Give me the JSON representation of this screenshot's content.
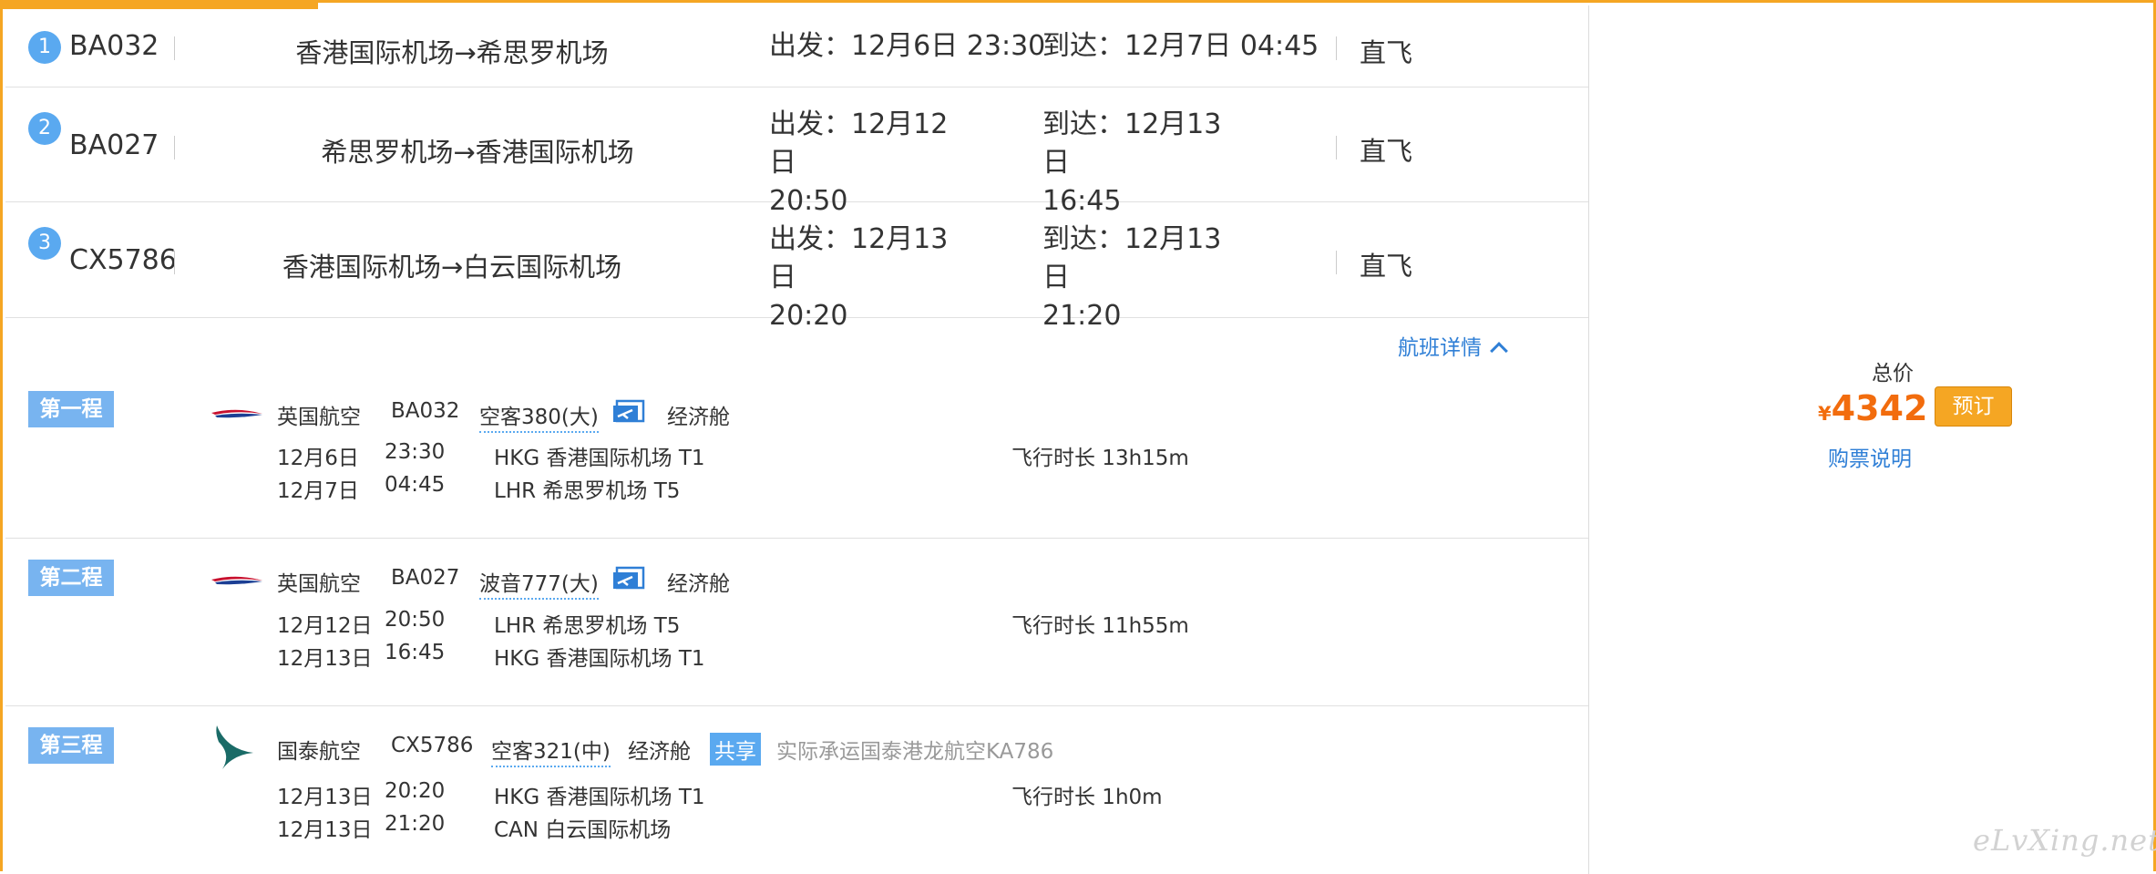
{
  "segments": [
    {
      "num": "1",
      "flight": "BA032",
      "route": "香港国际机场→希思罗机场",
      "dep_label": "出发：",
      "dep_date": "12月6日",
      "dep_time": "23:30",
      "arr_label": "到达：",
      "arr_date": "12月7日",
      "arr_time": "04:45",
      "type": "直飞"
    },
    {
      "num": "2",
      "flight": "BA027",
      "route": "希思罗机场→香港国际机场",
      "dep_label": "出发：",
      "dep_date": "12月12日",
      "dep_time": "20:50",
      "arr_label": "到达：",
      "arr_date": "12月13日",
      "arr_time": "16:45",
      "type": "直飞"
    },
    {
      "num": "3",
      "flight": "CX5786",
      "route": "香港国际机场→白云国际机场",
      "dep_label": "出发：",
      "dep_date": "12月13日",
      "dep_time": "20:20",
      "arr_label": "到达：",
      "arr_date": "12月13日",
      "arr_time": "21:20",
      "type": "直飞"
    }
  ],
  "details_link": "航班详情",
  "legs": [
    {
      "badge": "第一程",
      "airline": "英国航空",
      "flight": "BA032",
      "aircraft": "空客380(大)",
      "cabin": "经济舱",
      "has_meal": true,
      "dep_date": "12月6日",
      "dep_time": "23:30",
      "dep_airport": "HKG 香港国际机场 T1",
      "arr_date": "12月7日",
      "arr_time": "04:45",
      "arr_airport": "LHR 希思罗机场 T5",
      "duration": "飞行时长 13h15m"
    },
    {
      "badge": "第二程",
      "airline": "英国航空",
      "flight": "BA027",
      "aircraft": "波音777(大)",
      "cabin": "经济舱",
      "has_meal": true,
      "dep_date": "12月12日",
      "dep_time": "20:50",
      "dep_airport": "LHR 希思罗机场 T5",
      "arr_date": "12月13日",
      "arr_time": "16:45",
      "arr_airport": "HKG 香港国际机场 T1",
      "duration": "飞行时长 11h55m"
    },
    {
      "badge": "第三程",
      "airline": "国泰航空",
      "flight": "CX5786",
      "aircraft": "空客321(中)",
      "cabin": "经济舱",
      "share": "共享",
      "operated_by": "实际承运国泰港龙航空KA786",
      "dep_date": "12月13日",
      "dep_time": "20:20",
      "dep_airport": "HKG 香港国际机场 T1",
      "arr_date": "12月13日",
      "arr_time": "21:20",
      "arr_airport": "CAN 白云国际机场",
      "duration": "飞行时长 1h0m"
    }
  ],
  "pricing": {
    "total_label": "总价",
    "currency": "¥",
    "amount": "4342",
    "book_button": "预订",
    "ticket_info_link": "购票说明"
  },
  "watermark": "eLvXing.net",
  "colors": {
    "accent_orange": "#f5a623",
    "price_orange": "#f26c0d",
    "link_blue": "#2f7fd6",
    "badge_blue": "#78b4f0"
  },
  "icons": {
    "ba_logo": "british-airways-speedmarque-icon",
    "cx_logo": "cathay-pacific-brushwing-icon",
    "meal": "meal-screen-icon",
    "chevron": "chevron-up-icon"
  }
}
